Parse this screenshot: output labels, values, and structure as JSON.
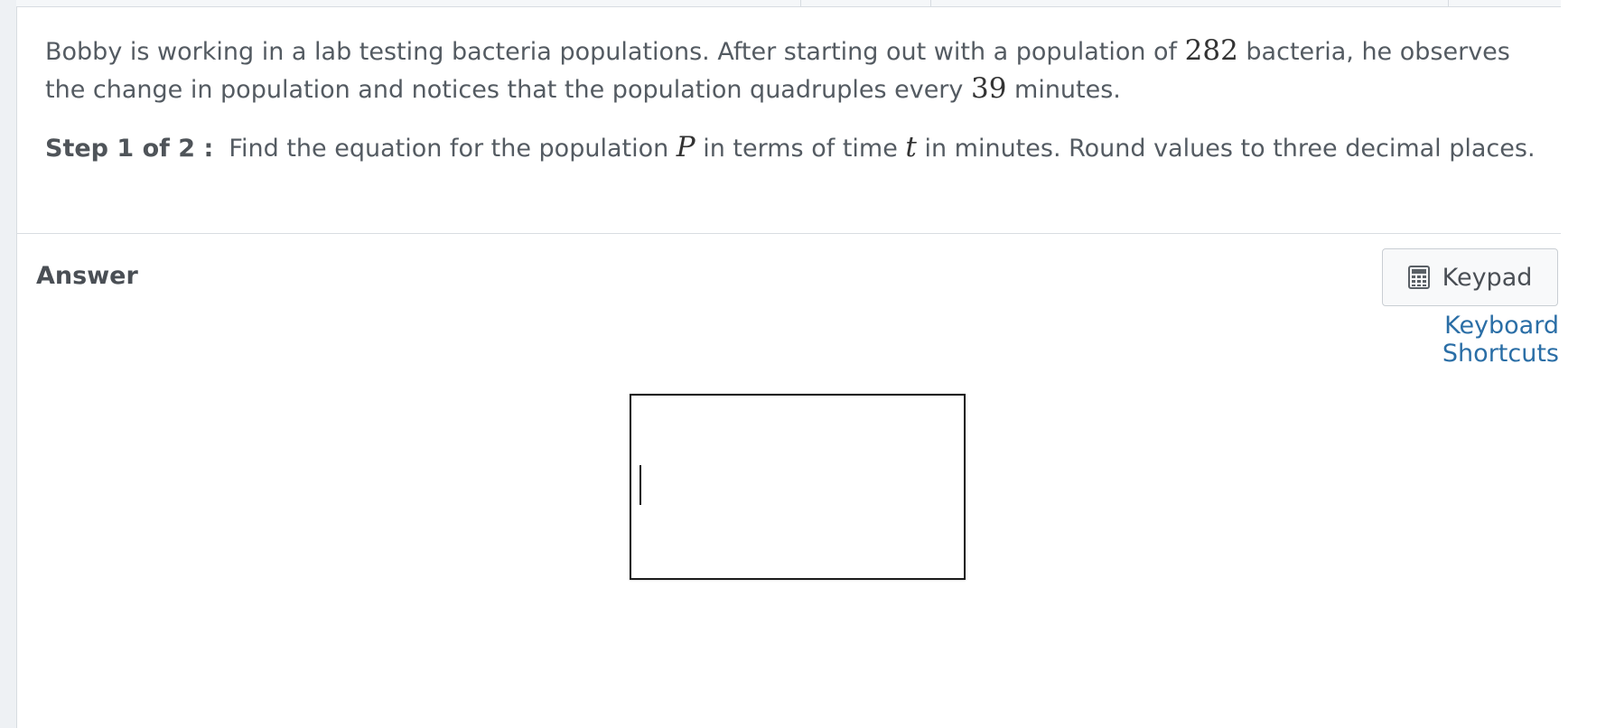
{
  "question": {
    "part1": "Bobby is working in a lab testing bacteria populations. After starting out with a population of ",
    "initial_population": "282",
    "part2": " bacteria, he observes the change in population and notices that the population quadruples every ",
    "period": "39",
    "part3": " minutes."
  },
  "step": {
    "label": "Step 1 of 2 :",
    "text1": "  Find the equation for the population ",
    "var_p": "P",
    "text2": " in terms of time ",
    "var_t": "t",
    "text3": " in minutes. Round values to three decimal places."
  },
  "answer": {
    "label": "Answer",
    "input_value": ""
  },
  "keypad": {
    "label": "Keypad",
    "icon": "calculator-icon"
  },
  "shortcuts": {
    "label": "Keyboard Shortcuts"
  },
  "colors": {
    "text": "#545b62",
    "link": "#2a6ea6",
    "gutter": "#eef1f4"
  }
}
